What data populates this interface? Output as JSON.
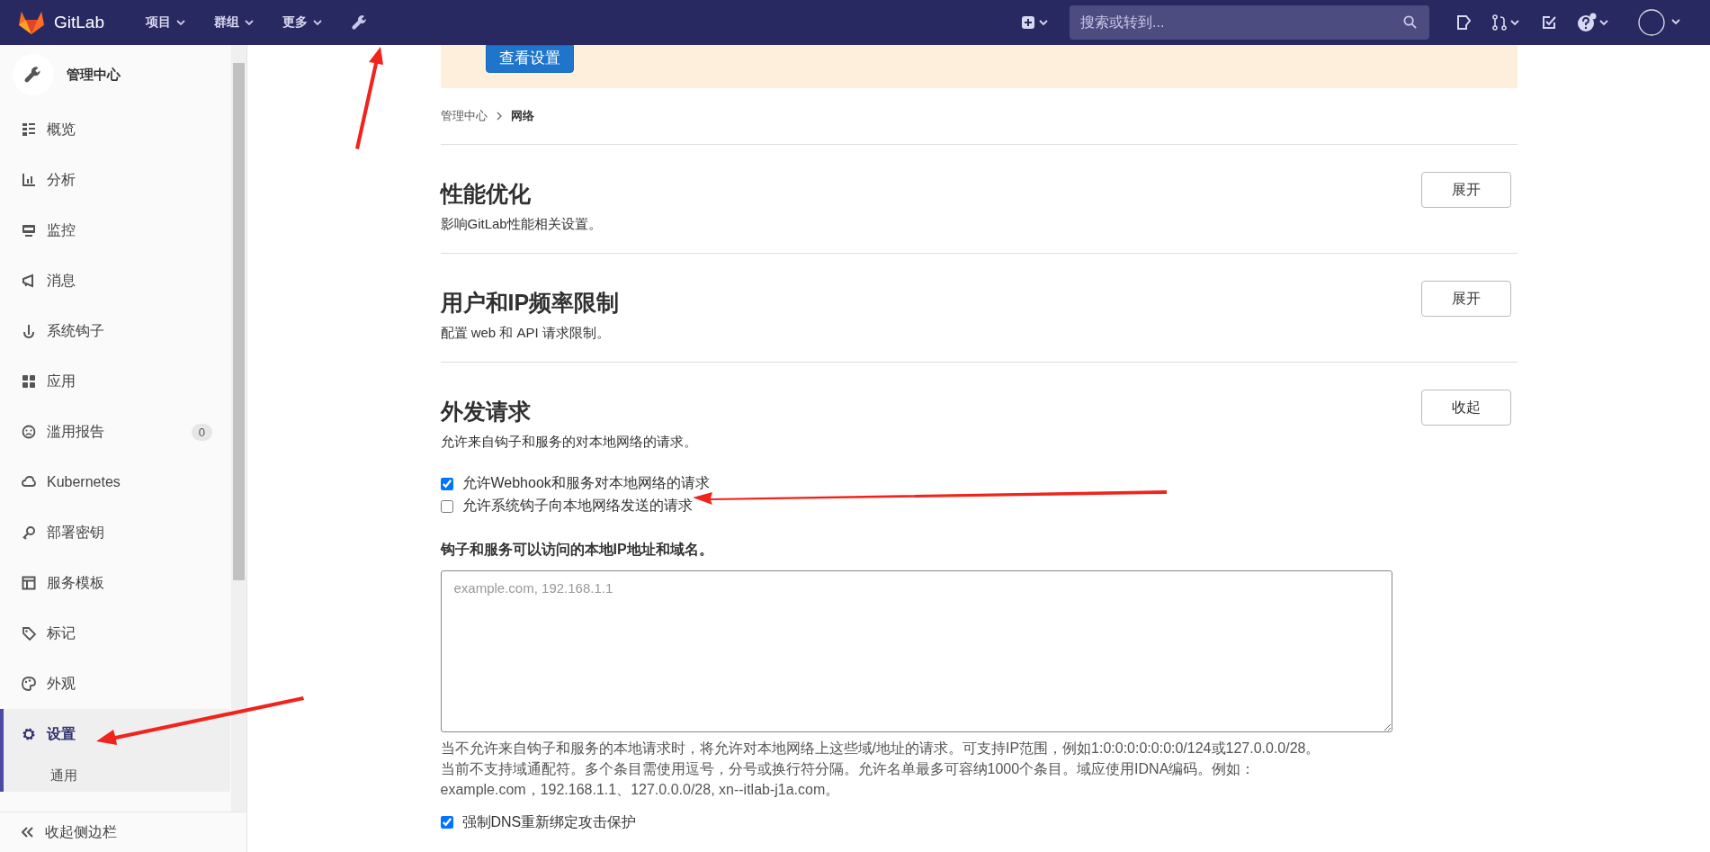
{
  "header": {
    "brand": "GitLab",
    "nav": [
      {
        "label": "项目"
      },
      {
        "label": "群组"
      },
      {
        "label": "更多"
      }
    ],
    "search": {
      "placeholder": "搜索或转到..."
    }
  },
  "sidebar": {
    "title": "管理中心",
    "items": [
      {
        "label": "概览",
        "selected": false
      },
      {
        "label": "分析",
        "selected": false
      },
      {
        "label": "监控",
        "selected": false
      },
      {
        "label": "消息",
        "selected": false
      },
      {
        "label": "系统钩子",
        "selected": false
      },
      {
        "label": "应用",
        "selected": false
      },
      {
        "label": "滥用报告",
        "selected": false,
        "badge": "0"
      },
      {
        "label": "Kubernetes",
        "selected": false
      },
      {
        "label": "部署密钥",
        "selected": false
      },
      {
        "label": "服务模板",
        "selected": false
      },
      {
        "label": "标记",
        "selected": false
      },
      {
        "label": "外观",
        "selected": false
      },
      {
        "label": "设置",
        "selected": true,
        "children": [
          {
            "label": "通用"
          }
        ]
      }
    ],
    "collapse": "收起侧边栏"
  },
  "banner": {
    "button": "查看设置"
  },
  "breadcrumb": [
    "管理中心",
    "网络"
  ],
  "sections": [
    {
      "title": "性能优化",
      "description": "影响GitLab性能相关设置。",
      "button": "展开"
    },
    {
      "title": "用户和IP频率限制",
      "description": "配置 web 和 API 请求限制。",
      "button": "展开"
    },
    {
      "title": "外发请求",
      "description": "允许来自钩子和服务的对本地网络的请求。",
      "button": "收起",
      "body": {
        "checkboxes": [
          {
            "label": "允许Webhook和服务对本地网络的请求",
            "checked": true
          },
          {
            "label": "允许系统钩子向本地网络发送的请求",
            "checked": false
          }
        ],
        "field_label": "钩子和服务可以访问的本地IP地址和域名。",
        "textarea": {
          "placeholder": "example.com, 192.168.1.1"
        },
        "help": "当不允许来自钩子和服务的本地请求时，将允许对本地网络上这些域/地址的请求。可支持IP范围，例如1:0:0:0:0:0:0:0/124或127.0.0.0/28。当前不支持域通配符。多个条目需使用逗号，分号或换行符分隔。允许名单最多可容纳1000个条目。域应使用IDNA编码。例如：example.com，192.168.1.1、127.0.0.0/28, xn--itlab-j1a.com。",
        "last_checkbox": {
          "label": "强制DNS重新绑定攻击保护",
          "checked": true
        }
      }
    }
  ]
}
